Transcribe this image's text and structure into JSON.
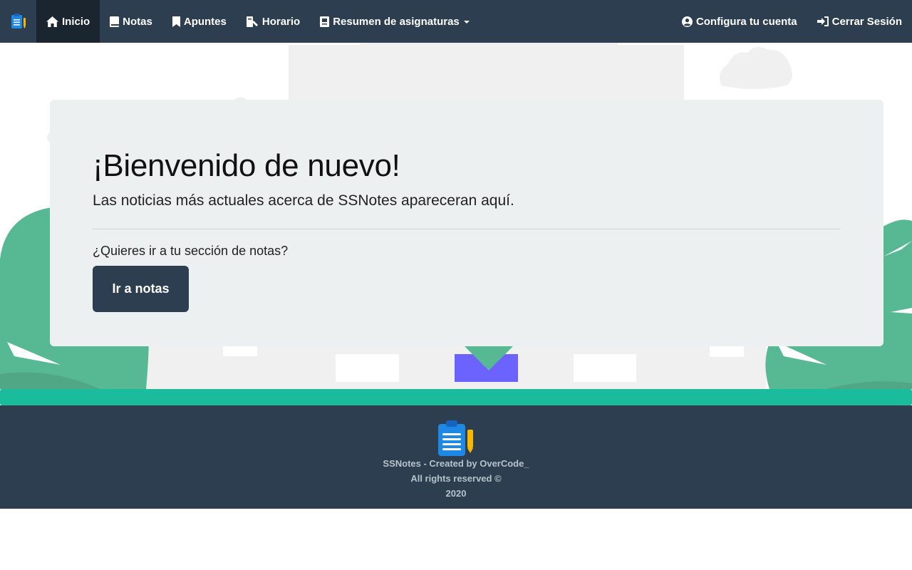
{
  "navbar": {
    "brand_icon": "clipboard-notes-logo",
    "items": [
      {
        "label": "Inicio",
        "icon": "home-icon",
        "active": true
      },
      {
        "label": "Notas",
        "icon": "book-icon"
      },
      {
        "label": "Apuntes",
        "icon": "bookmark-icon"
      },
      {
        "label": "Horario",
        "icon": "calendar-tools-icon"
      },
      {
        "label": "Resumen de asignaturas",
        "icon": "notebook-icon",
        "dropdown": true
      }
    ],
    "right_items": [
      {
        "label": "Configura tu cuenta",
        "icon": "user-circle-icon"
      },
      {
        "label": "Cerrar Sesión",
        "icon": "sign-in-icon"
      }
    ]
  },
  "jumbotron": {
    "title": "¡Bienvenido de nuevo!",
    "lead": "Las noticias más actuales acerca de SSNotes apareceran aquí.",
    "question": "¿Quieres ir a tu sección de notas?",
    "button_label": "Ir a notas"
  },
  "footer": {
    "line1": "SSNotes - Created by OverCode_",
    "line2": "All rights reserved ©",
    "line3": "2020"
  },
  "colors": {
    "navbar": "#2c3e50",
    "navbar_active": "#1a252f",
    "jumbotron": "#ecf0f1",
    "accent_teal": "#1abc9c",
    "bush_green": "#57b894",
    "envelope_purple": "#6c63ff"
  }
}
